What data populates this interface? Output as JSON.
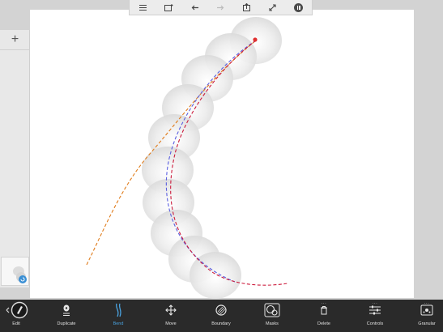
{
  "top_toolbar": {
    "items": [
      {
        "name": "menu",
        "icon": "menu-icon"
      },
      {
        "name": "new-layer",
        "icon": "new-frame-icon"
      },
      {
        "name": "undo",
        "icon": "undo-arrow-icon"
      },
      {
        "name": "redo",
        "icon": "redo-arrow-icon",
        "enabled": false
      },
      {
        "name": "export",
        "icon": "export-icon"
      },
      {
        "name": "fullscreen",
        "icon": "expand-icon"
      },
      {
        "name": "pause",
        "icon": "pause-icon"
      }
    ]
  },
  "left_panel": {
    "add_symbol": "+"
  },
  "bottom_toolbar": {
    "items": [
      {
        "label": "Edit",
        "icon": "edit-dial-icon"
      },
      {
        "label": "Duplicate",
        "icon": "duplicate-icon"
      },
      {
        "label": "Bend",
        "icon": "bend-icon",
        "active": true
      },
      {
        "label": "Move",
        "icon": "move-arrows-icon"
      },
      {
        "label": "Boundary",
        "icon": "boundary-icon"
      },
      {
        "label": "Masks",
        "icon": "masks-icon"
      },
      {
        "label": "Delete",
        "icon": "trash-icon"
      },
      {
        "label": "Controls",
        "icon": "sliders-icon"
      },
      {
        "label": "Granular",
        "icon": "granular-icon"
      }
    ]
  },
  "colors": {
    "accent": "#4aa3e0",
    "bottom_bar": "#2a2a2a",
    "path_orange": "#e07b1a",
    "path_blue": "#5a5ee0",
    "path_red": "#cc1b3c",
    "handle": "#e03030"
  }
}
